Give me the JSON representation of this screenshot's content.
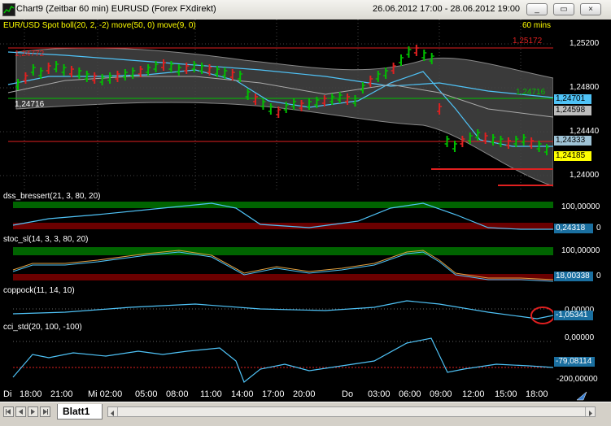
{
  "window": {
    "title": "Chart9 (Zeitbar 60 min)  EURUSD (Forex FXdirekt)",
    "date_range": "26.06.2012 17:00 - 28.06.2012 19:00",
    "buttons": {
      "minimize": "_",
      "maximize": "▭",
      "close": "×"
    }
  },
  "price_panel": {
    "header": "EUR/USD Spot boll(20, 2, -2) move(50, 0) move(9, 0)",
    "timeframe": "60 mins",
    "axis_labels": [
      "1,25200",
      "1,24800",
      "1,24440",
      "1,24000"
    ],
    "line_labels": {
      "top_red": "1,25172",
      "left_red": "1,24772",
      "green": "1,24716",
      "green_left": "1,24716"
    },
    "price_tags": [
      {
        "text": "1,24701",
        "color": "#4fc3f7",
        "text_color": "#000000"
      },
      {
        "text": "1,24598",
        "color": "#bdbdbd",
        "text_color": "#000000"
      },
      {
        "text": "1,24333",
        "color": "#9ec3d6",
        "text_color": "#000000"
      },
      {
        "text": "1,24185",
        "color": "#ffff00",
        "text_color": "#000000"
      }
    ]
  },
  "panels": [
    {
      "header": "dss_bressert(21, 3, 80, 20)",
      "axis_top": "100,00000",
      "axis_bottom": "0",
      "value": "0,24318",
      "tag_color": "#1a6fa0"
    },
    {
      "header": "stoc_sl(14, 3, 3, 80, 20)",
      "axis_top": "100,00000",
      "axis_bottom": "0",
      "value": "18,00338",
      "tag_color": "#1a6fa0"
    },
    {
      "header": "coppock(11, 14, 10)",
      "axis_top": "0,00000",
      "axis_bottom": "",
      "value": "-1,05341",
      "tag_color": "#1a6fa0"
    },
    {
      "header": "cci_std(20, 100, -100)",
      "axis_top": "0,00000",
      "axis_bottom": "-200,00000",
      "value": "-79,08114",
      "tag_color": "#1a6fa0"
    }
  ],
  "time_axis": [
    "Di",
    "18:00",
    "21:00",
    "Mi 02:00",
    "05:00",
    "08:00",
    "11:00",
    "14:00",
    "17:00",
    "20:00",
    "Do",
    "03:00",
    "06:00",
    "09:00",
    "12:00",
    "15:00",
    "18:00"
  ],
  "sheet_tab": "Blatt1",
  "colors": {
    "bullish": "#00c000",
    "bearish": "#e02020",
    "background": "#000000",
    "ma_blue": "#4fc3f7",
    "band_fill": "#3c3c3c"
  }
}
